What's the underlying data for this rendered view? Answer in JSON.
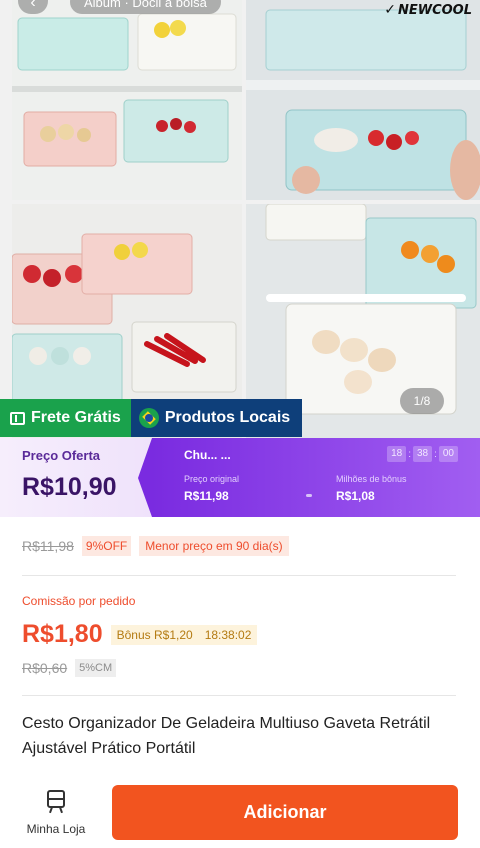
{
  "gallery": {
    "top_pill": "Álbum · Dócil à bolsa",
    "brand_logo": "NEWCOOL",
    "counter": "1/8"
  },
  "badges": {
    "shipping": "Frete Grátis",
    "local": "Produtos Locais"
  },
  "offer": {
    "label": "Preço Oferta",
    "price": "R$10,90",
    "campaign_title": "Chu... ...",
    "timer": [
      "18",
      "38",
      "00"
    ],
    "original_caption": "Preço original",
    "original_value": "R$11,98",
    "bonus_caption": "Milhões de bônus",
    "bonus_value": "R$1,08"
  },
  "price_info": {
    "old_price": "R$11,98",
    "discount": "9%OFF",
    "lowest": "Menor preço em 90 dia(s)"
  },
  "commission": {
    "label": "Comissão por pedido",
    "value": "R$1,80",
    "bonus": "Bônus R$1,20",
    "bonus_timer": "18:38:02",
    "old_value": "R$0,60",
    "cm": "5%CM"
  },
  "product": {
    "title": "Cesto Organizador De Geladeira Multiuso Gaveta Retrátil Ajustável Prático Portátil"
  },
  "bottom_bar": {
    "store_label": "Minha Loja",
    "add_label": "Adicionar"
  },
  "colors": {
    "shopee_orange": "#ee4d2d",
    "button_orange": "#f2541f",
    "offer_purple": "#7a2be0",
    "badge_green": "#1aa24c",
    "badge_navy": "#0e3f7a"
  }
}
